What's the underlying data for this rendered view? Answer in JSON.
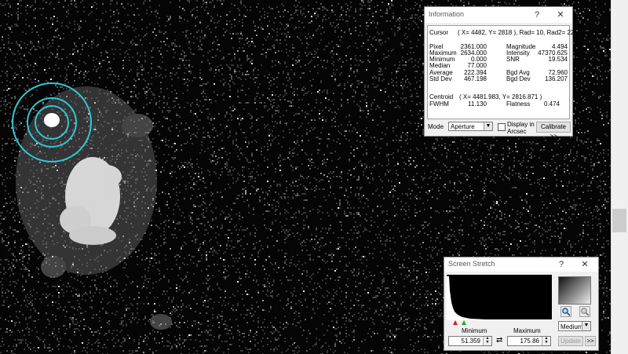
{
  "information": {
    "title": "Information",
    "help_glyph": "?",
    "close_glyph": "✕",
    "cursor_label": "Cursor",
    "cursor_value": "( X= 4482, Y= 2818 ), Rad= 10, Rad2= 22",
    "stats_left": [
      {
        "label": "Pixel",
        "value": "2361.000"
      },
      {
        "label": "Maximum",
        "value": "2634.000"
      },
      {
        "label": "Minimum",
        "value": "0.000"
      },
      {
        "label": "Median",
        "value": "77.000"
      },
      {
        "label": "Average",
        "value": "222.394"
      },
      {
        "label": "Std Dev",
        "value": "467.198"
      }
    ],
    "stats_right": [
      {
        "label": "Magnitude",
        "value": "4.494"
      },
      {
        "label": "Intensity",
        "value": "47370.625"
      },
      {
        "label": "SNR",
        "value": "19.534"
      },
      {
        "label": "Bgd Avg",
        "value": "72.960"
      },
      {
        "label": "Bgd Dev",
        "value": "136.207"
      }
    ],
    "centroid_label": "Centroid",
    "centroid_value": "( X= 4481.983, Y= 2816.871 )",
    "fwhm_label": "FWHM",
    "fwhm_value": "11.130",
    "flatness_label": "Flatness",
    "flatness_value": "0.474",
    "mode_label": "Mode",
    "mode_value": "Aperture",
    "arcsec_label_1": "Display in",
    "arcsec_label_2": "Arcsec",
    "calibrate_label": "Calibrate >>"
  },
  "screen_stretch": {
    "title": "Screen Stretch",
    "help_glyph": "?",
    "close_glyph": "✕",
    "minimum_label": "Minimum",
    "maximum_label": "Maximum",
    "minimum_value": "51.359",
    "maximum_value": "175.86",
    "swap_glyph": "⇄",
    "preset_value": "Medium",
    "update_label": "Update",
    "more_label": ">>"
  },
  "colors": {
    "aperture_ring": "#2ec8d8",
    "background": "#050505"
  },
  "icons": {
    "zoom_in": "zoom-in-icon",
    "zoom_out": "zoom-out-icon"
  }
}
